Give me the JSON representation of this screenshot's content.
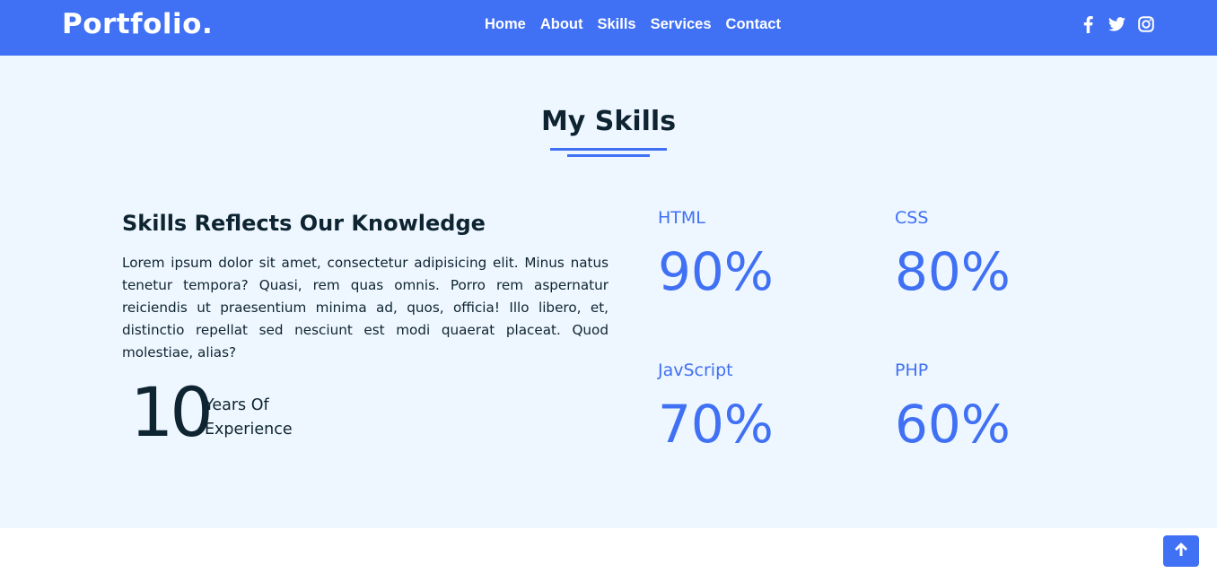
{
  "header": {
    "logo": "Portfolio.",
    "nav": [
      "Home",
      "About",
      "Skills",
      "Services",
      "Contact"
    ],
    "social_icons": [
      "facebook-icon",
      "twitter-icon",
      "instagram-icon"
    ]
  },
  "skills": {
    "title": "My Skills",
    "subheading": "Skills Reflects Our Knowledge",
    "paragraph": "Lorem ipsum dolor sit amet, consectetur adipisicing elit. Minus natus tenetur tempora? Quasi, rem quas omnis. Porro rem aspernatur reiciendis ut praesentium minima ad, quos, officia! Illo libero, et, distinctio repellat sed nesciunt est modi quaerat placeat. Quod molestiae, alias?",
    "experience": {
      "number": "10",
      "label_line1": "Years Of",
      "label_line2": "Experience"
    },
    "items": [
      {
        "name": "HTML",
        "percent": "90%"
      },
      {
        "name": "CSS",
        "percent": "80%"
      },
      {
        "name": "JavScript",
        "percent": "70%"
      },
      {
        "name": "PHP",
        "percent": "60%"
      }
    ]
  },
  "scroll_top_icon": "arrow-up-icon",
  "colors": {
    "accent": "#4070f4",
    "section_bg": "#eef7ff",
    "dark_text": "#0e2431"
  }
}
